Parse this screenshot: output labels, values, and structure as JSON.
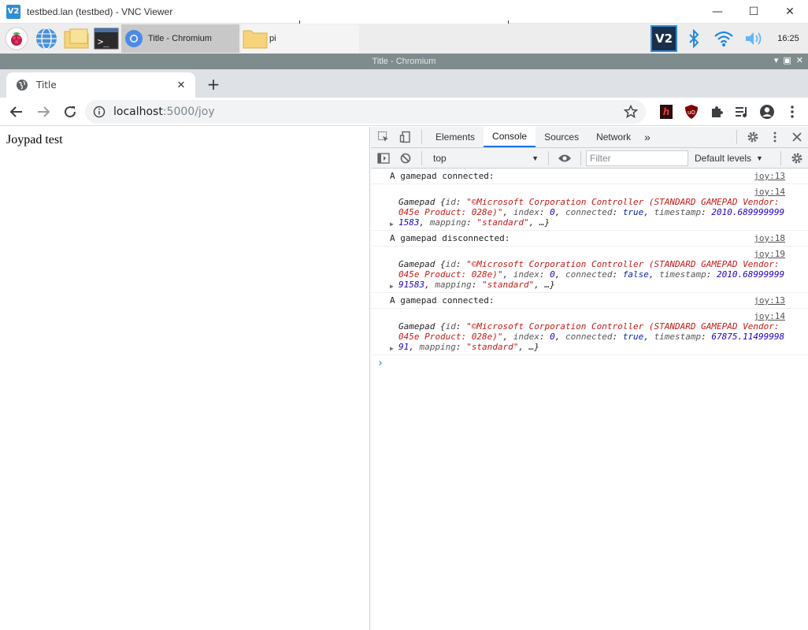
{
  "vnc": {
    "logo": "V2",
    "title": "testbed.lan (testbed) - VNC Viewer",
    "minimize": "—",
    "maximize": "☐",
    "close": "✕"
  },
  "taskbar": {
    "tasks": [
      {
        "label": "Title - Chromium"
      },
      {
        "label": "pi"
      }
    ],
    "tray_vnc": "V2",
    "time": "16:25"
  },
  "chromium": {
    "window_title": "Title - Chromium",
    "tab_title": "Title",
    "url_host": "localhost",
    "url_path": ":5000/joy"
  },
  "page": {
    "heading": "Joypad test"
  },
  "devtools": {
    "tabs": [
      "Elements",
      "Console",
      "Sources",
      "Network"
    ],
    "active_tab": "Console",
    "more": "»",
    "context": "top",
    "filter_placeholder": "Filter",
    "levels": "Default levels",
    "messages": [
      {
        "type": "text",
        "text": "A gamepad connected:",
        "src": "joy:13"
      },
      {
        "type": "object",
        "src": "joy:14",
        "name": "Gamepad",
        "id": "\"©Microsoft Corporation Controller (STANDARD GAMEPAD Vendor: 045e Product: 028e)\"",
        "index": "0",
        "connected": "true",
        "timestamp": "2010.6899999991583",
        "mapping": "\"standard\""
      },
      {
        "type": "text",
        "text": "A gamepad disconnected:",
        "src": "joy:18"
      },
      {
        "type": "object",
        "src": "joy:19",
        "name": "Gamepad",
        "id": "\"©Microsoft Corporation Controller (STANDARD GAMEPAD Vendor: 045e Product: 028e)\"",
        "index": "0",
        "connected": "false",
        "timestamp": "2010.6899999991583",
        "mapping": "\"standard\""
      },
      {
        "type": "text",
        "text": "A gamepad connected:",
        "src": "joy:13"
      },
      {
        "type": "object",
        "src": "joy:14",
        "name": "Gamepad",
        "id": "\"©Microsoft Corporation Controller (STANDARD GAMEPAD Vendor: 045e Product: 028e)\"",
        "index": "0",
        "connected": "true",
        "timestamp": "67875.1149999891",
        "mapping": "\"standard\""
      }
    ],
    "prompt": "›"
  },
  "colors": {
    "accent": "#1a73e8",
    "string": "#c41a16",
    "number": "#1c00cf"
  }
}
